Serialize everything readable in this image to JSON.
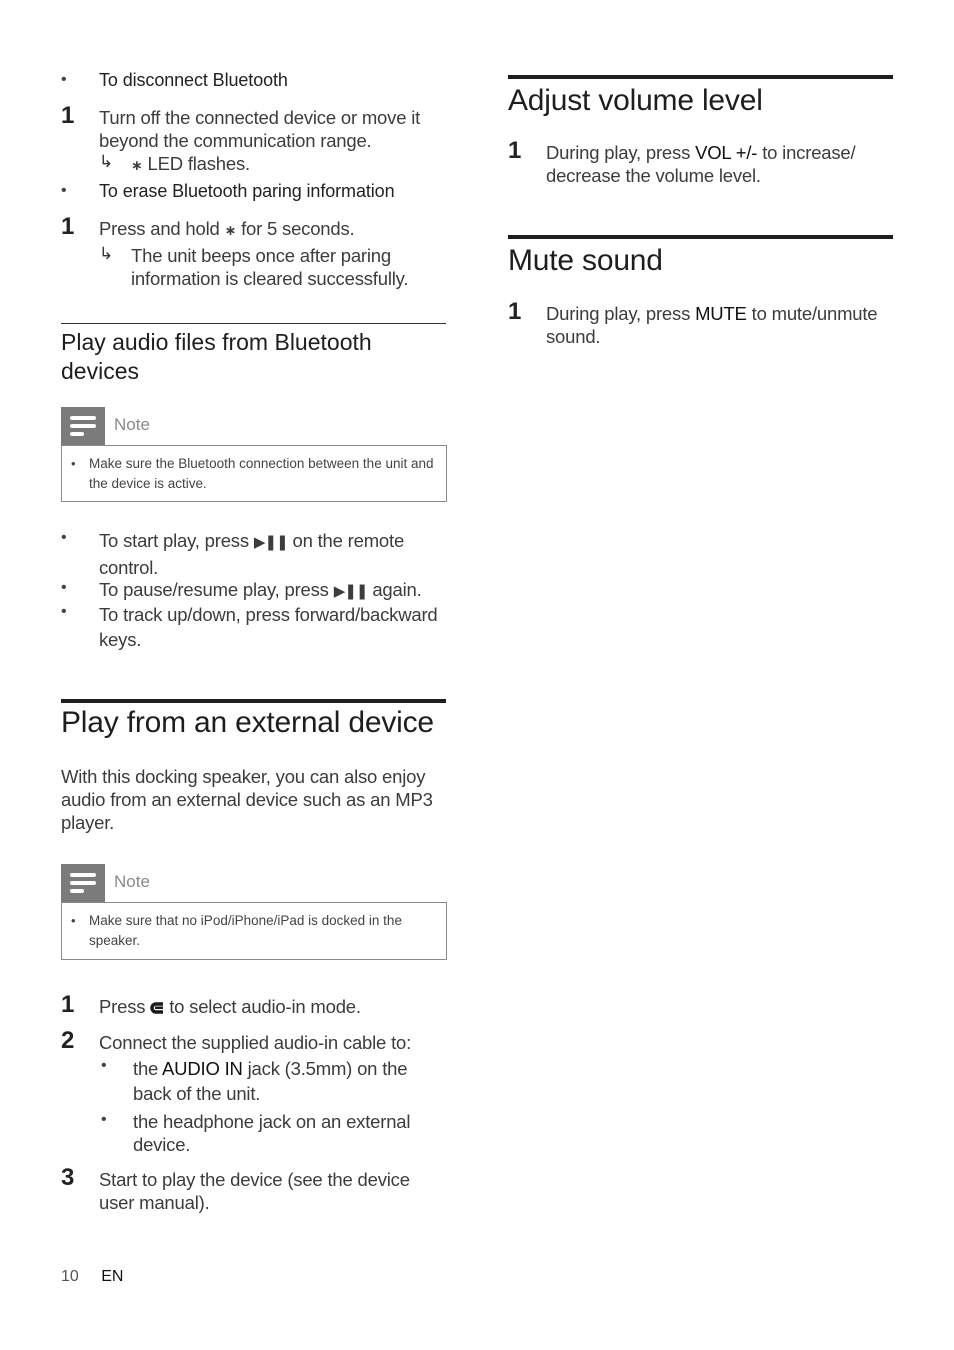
{
  "left_column": {
    "disconnect": {
      "heading": "To disconnect Bluetooth",
      "step_num": "1",
      "step_text": "Turn off the connected device or move it beyond the communication range.",
      "result_text": "LED flashes."
    },
    "erase": {
      "heading": "To erase Bluetooth paring information",
      "step_num": "1",
      "step_pre": "Press and hold",
      "step_post": "for 5 seconds.",
      "result_text": "The unit beeps once after paring information is cleared successfully."
    },
    "play_audio_section": {
      "title": "Play audio files from Bluetooth devices",
      "note_label": "Note",
      "note_text": "Make sure the Bluetooth connection between the unit and the device is active.",
      "bullets": [
        {
          "pre": "To start play, press",
          "post": "on the remote control."
        },
        {
          "pre": "To pause/resume play, press",
          "post": "again."
        },
        {
          "pre": "To track up/down, press forward/backward keys.",
          "post": ""
        }
      ]
    },
    "external_section": {
      "title": "Play from an external device",
      "intro": "With this docking speaker, you can also enjoy audio from an external device such as an MP3 player.",
      "note_label": "Note",
      "note_text": "Make sure that no iPod/iPhone/iPad is docked in the speaker.",
      "steps": [
        {
          "num": "1",
          "pre": "Press",
          "post": "to select audio-in mode."
        },
        {
          "num": "2",
          "text": "Connect the supplied audio-in cable to:"
        },
        {
          "num": "3",
          "text": "Start to play the device (see the device user manual)."
        }
      ],
      "sub_bullets": [
        {
          "pre": "the",
          "strong": "AUDIO IN",
          "post": "jack (3.5mm) on the back of the unit."
        },
        {
          "text": "the headphone jack on an external device."
        }
      ]
    }
  },
  "right_column": {
    "volume_section": {
      "title": "Adjust volume level",
      "step_num": "1",
      "pre": "During play, press",
      "strong": "VOL +/-",
      "post": "to increase/ decrease the volume level."
    },
    "mute_section": {
      "title": "Mute sound",
      "step_num": "1",
      "pre": "During play, press",
      "strong": "MUTE",
      "post": "to mute/unmute sound."
    }
  },
  "icons": {
    "bluetooth": "bluetooth-icon",
    "play_pause": "play-pause-icon",
    "source": "source-icon",
    "arrow": "result-arrow-icon",
    "note": "note-icon"
  },
  "glyphs": {
    "bullet": "•",
    "arrow": "↳",
    "bluetooth": "✱",
    "play_pause": "▶❚❚"
  },
  "footer": {
    "page_number": "10",
    "language": "EN"
  }
}
